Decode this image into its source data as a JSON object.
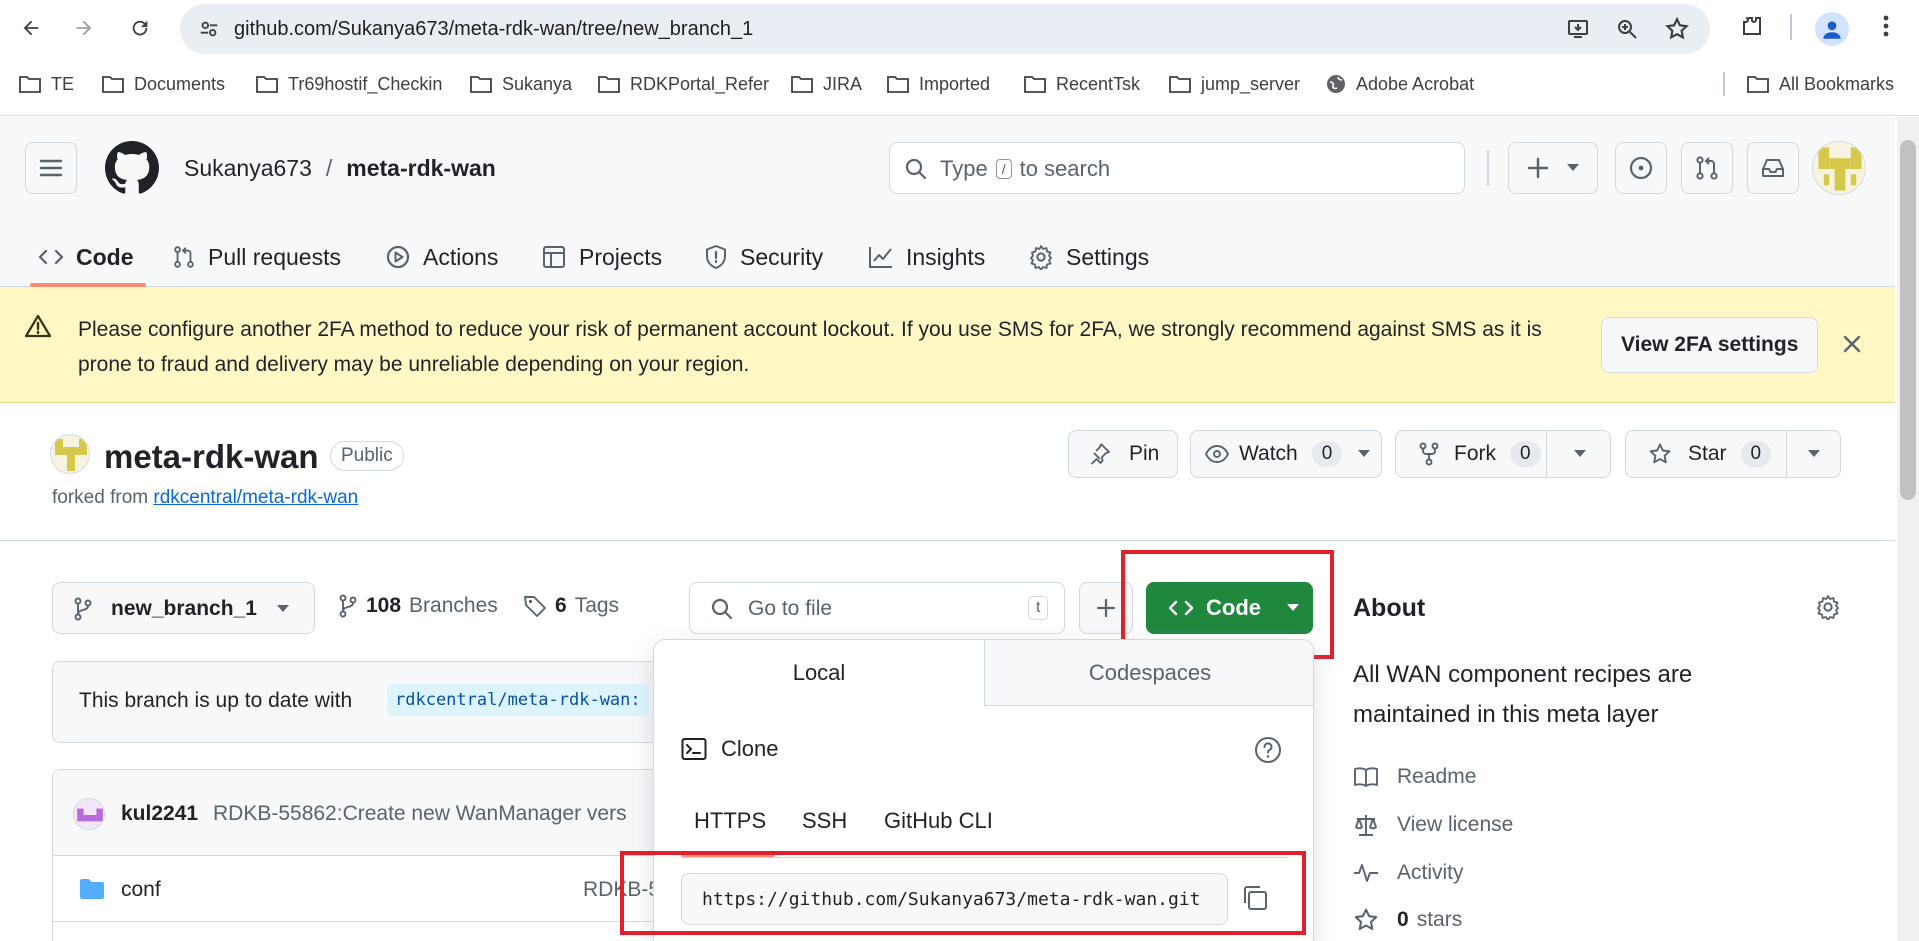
{
  "browser": {
    "url": "github.com/Sukanya673/meta-rdk-wan/tree/new_branch_1",
    "bookmarks": [
      "TE",
      "Documents",
      "Tr69hostif_Checkin",
      "Sukanya",
      "RDKPortal_Refer",
      "JIRA",
      "Imported",
      "RecentTsk",
      "jump_server",
      "Adobe Acrobat"
    ],
    "all_bookmarks": "All Bookmarks"
  },
  "header": {
    "owner": "Sukanya673",
    "separator": "/",
    "repo": "meta-rdk-wan",
    "search_prefix": "Type",
    "search_key": "/",
    "search_suffix": "to search"
  },
  "tabs": [
    {
      "label": "Code",
      "icon": "code-icon"
    },
    {
      "label": "Pull requests",
      "icon": "pull-request-icon"
    },
    {
      "label": "Actions",
      "icon": "actions-icon"
    },
    {
      "label": "Projects",
      "icon": "projects-icon"
    },
    {
      "label": "Security",
      "icon": "shield-icon"
    },
    {
      "label": "Insights",
      "icon": "graph-icon"
    },
    {
      "label": "Settings",
      "icon": "gear-icon"
    }
  ],
  "banner": {
    "text": "Please configure another 2FA method to reduce your risk of permanent account lockout. If you use SMS for 2FA, we strongly recommend against SMS as it is prone to fraud and delivery may be unreliable depending on your region.",
    "button": "View 2FA settings"
  },
  "repo": {
    "title": "meta-rdk-wan",
    "visibility": "Public",
    "forked_prefix": "forked from",
    "forked_link": "rdkcentral/meta-rdk-wan",
    "pin": "Pin",
    "watch": "Watch",
    "watch_count": "0",
    "fork": "Fork",
    "fork_count": "0",
    "star": "Star",
    "star_count": "0"
  },
  "files": {
    "branch": "new_branch_1",
    "branches_count": "108",
    "branches_label": "Branches",
    "tags_count": "6",
    "tags_label": "Tags",
    "goto_placeholder": "Go to file",
    "goto_key": "t",
    "code_button": "Code",
    "uptodate_text": "This branch is up to date with",
    "uptodate_ref": "rdkcentral/meta-rdk-wan:",
    "commit_author": "kul2241",
    "commit_message": "RDKB-55862:Create new WanManager vers",
    "rows": [
      {
        "name": "conf",
        "commit": "RDKB-5"
      }
    ]
  },
  "popover": {
    "tab_local": "Local",
    "tab_codespaces": "Codespaces",
    "clone_label": "Clone",
    "proto_https": "HTTPS",
    "proto_ssh": "SSH",
    "proto_cli": "GitHub CLI",
    "clone_url": "https://github.com/Sukanya673/meta-rdk-wan.git"
  },
  "about": {
    "title": "About",
    "description": "All WAN component recipes are maintained in this meta layer",
    "readme": "Readme",
    "license": "View license",
    "activity": "Activity",
    "stars_count": "0",
    "stars_label": "stars"
  },
  "colors": {
    "primary_green": "#1f883d",
    "banner_bg": "#fff8c5",
    "link_blue": "#0969da",
    "highlight_red": "#e0202a",
    "tab_underline": "#fd8c73"
  }
}
